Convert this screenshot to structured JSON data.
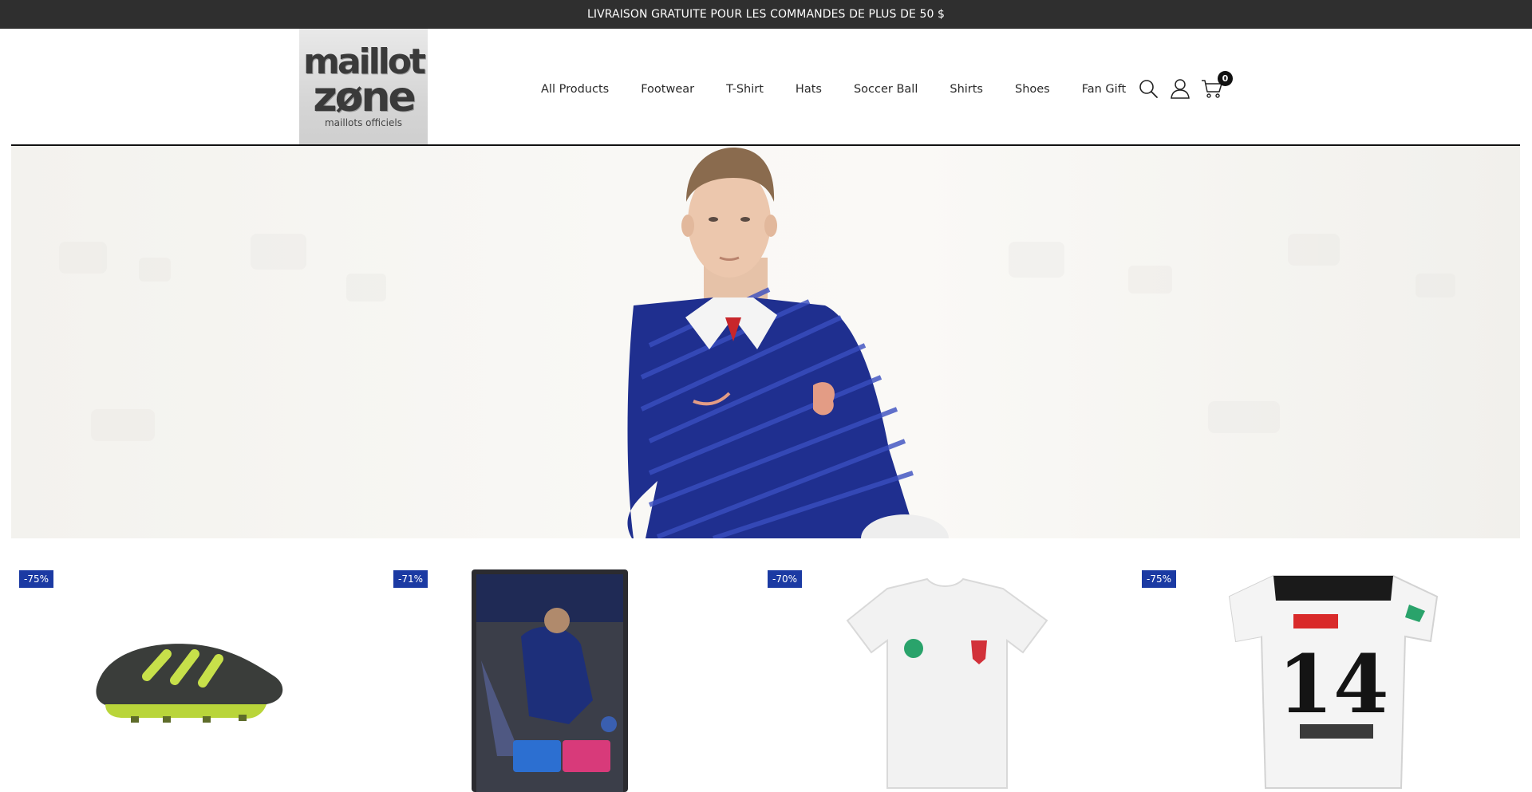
{
  "announcement": {
    "text": "LIVRAISON GRATUITE POUR LES COMMANDES DE PLUS DE 50 $"
  },
  "logo": {
    "line1": "maillot",
    "line2": "zøne",
    "tagline": "maillots officiels"
  },
  "nav": {
    "items": [
      {
        "label": "All Products"
      },
      {
        "label": "Footwear"
      },
      {
        "label": "T-Shirt"
      },
      {
        "label": "Hats"
      },
      {
        "label": "Soccer Ball"
      },
      {
        "label": "Shirts"
      },
      {
        "label": "Shoes"
      },
      {
        "label": "Fan Gift"
      }
    ]
  },
  "header_icons": {
    "search": "search-icon",
    "account": "user-icon",
    "cart": "cart-icon",
    "cart_count": "0"
  },
  "products": [
    {
      "discount": "-75%",
      "image": "soccer-cleat"
    },
    {
      "discount": "-71%",
      "image": "trading-card"
    },
    {
      "discount": "-70%",
      "image": "white-tshirt"
    },
    {
      "discount": "-75%",
      "image": "white-jersey-14"
    }
  ],
  "colors": {
    "announcement_bg": "#2f2f2f",
    "badge_bg": "#1b3aa3",
    "jersey_blue": "#1f2f8f"
  }
}
